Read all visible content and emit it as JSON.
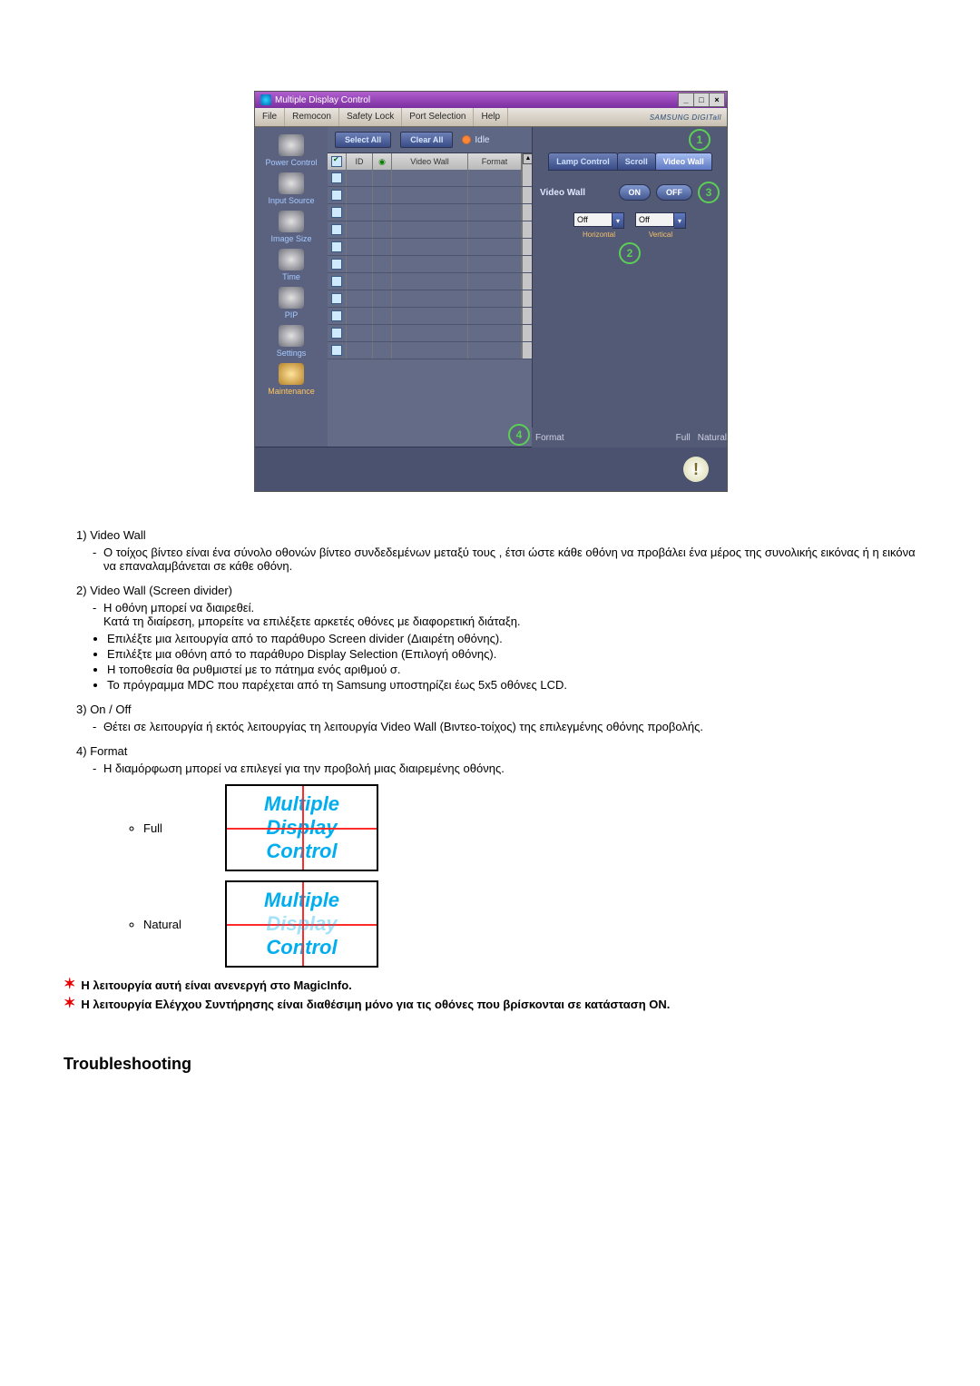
{
  "window": {
    "title": "Multiple Display Control",
    "menu": [
      "File",
      "Remocon",
      "Safety Lock",
      "Port Selection",
      "Help"
    ],
    "brand": "SAMSUNG DIGITall"
  },
  "sidebar": [
    {
      "label": "Power Control"
    },
    {
      "label": "Input Source"
    },
    {
      "label": "Image Size"
    },
    {
      "label": "Time"
    },
    {
      "label": "PIP"
    },
    {
      "label": "Settings"
    },
    {
      "label": "Maintenance",
      "active": true
    }
  ],
  "toolbar": {
    "select_all": "Select All",
    "clear_all": "Clear All",
    "idle": "Idle"
  },
  "table": {
    "headers": {
      "id": "ID",
      "video_wall": "Video Wall",
      "format": "Format"
    },
    "row_count": 11
  },
  "right": {
    "tabs": [
      "Lamp Control",
      "Scroll",
      "Video Wall"
    ],
    "active_tab": 2,
    "onoff": {
      "label": "Video Wall",
      "on": "ON",
      "off": "OFF"
    },
    "dd": {
      "h_val": "Off",
      "h_lbl": "Horizontal",
      "v_val": "Off",
      "v_lbl": "Vertical"
    },
    "format": {
      "label": "Format",
      "full": "Full",
      "natural": "Natural"
    }
  },
  "badges": {
    "b1": "1",
    "b2": "2",
    "b3": "3",
    "b4": "4"
  },
  "list": {
    "i1": {
      "num": "1)",
      "title": "Video Wall",
      "desc": "Ο τοίχος βίντεο είναι ένα σύνολο οθονών βίντεο συνδεδεμένων μεταξύ τους , έτσι ώστε κάθε οθόνη να προβάλει ένα μέρος της συνολικής εικόνας ή η εικόνα να επαναλαμβάνεται σε κάθε οθόνη."
    },
    "i2": {
      "num": "2)",
      "title": "Video Wall (Screen divider)",
      "desc": "Η οθόνη μπορεί να διαιρεθεί.",
      "desc2": "Κατά τη διαίρεση, μπορείτε να επιλέξετε αρκετές οθόνες με διαφορετική διάταξη.",
      "bul": [
        "Επιλέξτε μια λειτουργία από το παράθυρο Screen divider (Διαιρέτη οθόνης).",
        "Επιλέξτε μια οθόνη από το παράθυρο Display Selection (Επιλογή οθόνης).",
        "Η τοποθεσία θα ρυθμιστεί με το πάτημα ενός αριθμού σ.",
        "Το πρόγραμμα MDC που παρέχεται από τη Samsung υποστηρίζει έως 5x5 οθόνες LCD."
      ]
    },
    "i3": {
      "num": "3)",
      "title": "On / Off",
      "desc": "Θέτει σε λειτουργία ή εκτός λειτουργίας τη λειτουργία Video Wall (Βιντεο-τοίχος) της επιλεγμένης οθόνης προβολής."
    },
    "i4": {
      "num": "4)",
      "title": "Format",
      "desc": "Η διαμόρφωση μπορεί να επιλεγεί για την προβολή μιας διαιρεμένης οθόνης.",
      "full": "Full",
      "natural": "Natural",
      "fmt_t1": "Multiple",
      "fmt_t2": "Display",
      "fmt_t3": "Control"
    }
  },
  "notes": {
    "n1": "Η λειτουργία αυτή είναι ανενεργή στο MagicInfo.",
    "n2": "Η λειτουργία Ελέγχου Συντήρησης είναι διαθέσιμη μόνο για τις οθόνες που βρίσκονται σε κατάσταση ON."
  },
  "section_title": "Troubleshooting"
}
